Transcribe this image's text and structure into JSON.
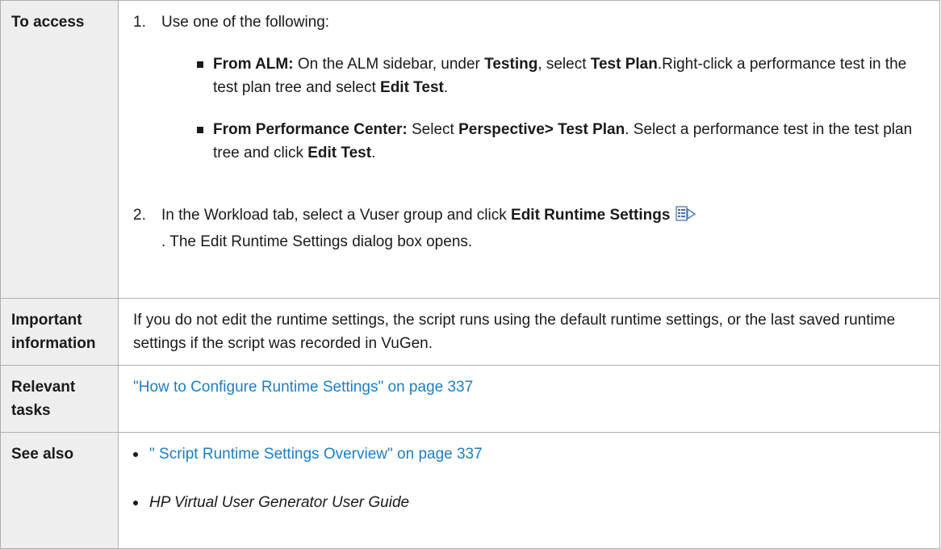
{
  "access": {
    "label": "To access",
    "step1_num": "1.",
    "step1_text": "Use one of the following:",
    "alm": {
      "head": "From ALM:",
      "t1": " On the ALM sidebar, under ",
      "b1": "Testing",
      "t2": ", select ",
      "b2": "Test Plan",
      "t3": ".Right-click a performance test in the test plan tree and select ",
      "b3": "Edit Test",
      "t4": "."
    },
    "pc": {
      "head": "From Performance Center:",
      "t1": " Select ",
      "b1": "Perspective> Test Plan",
      "t2": ". Select a performance test in the test plan tree and click ",
      "b2": "Edit Test",
      "t3": "."
    },
    "step2_num": "2.",
    "step2": {
      "t1": "In the Workload tab, select a Vuser group and click ",
      "b1": "Edit Runtime Settings",
      "t2": ". The Edit Runtime Settings dialog box opens."
    },
    "icon": "edit-runtime-settings-icon"
  },
  "important": {
    "label": "Important information",
    "text": "If you do not edit the runtime settings, the script runs using the default runtime settings, or the last saved runtime settings if the script was recorded in VuGen."
  },
  "relevant": {
    "label": "Relevant tasks",
    "link": "\"How to Configure Runtime Settings\" on page 337"
  },
  "see_also": {
    "label": "See also",
    "link": "\" Script Runtime Settings Overview\" on page 337",
    "guide": "HP Virtual User Generator User Guide"
  },
  "colors": {
    "link": "#1f7dc2",
    "label_bg": "#eeeeee",
    "border": "#b0b0b0"
  }
}
